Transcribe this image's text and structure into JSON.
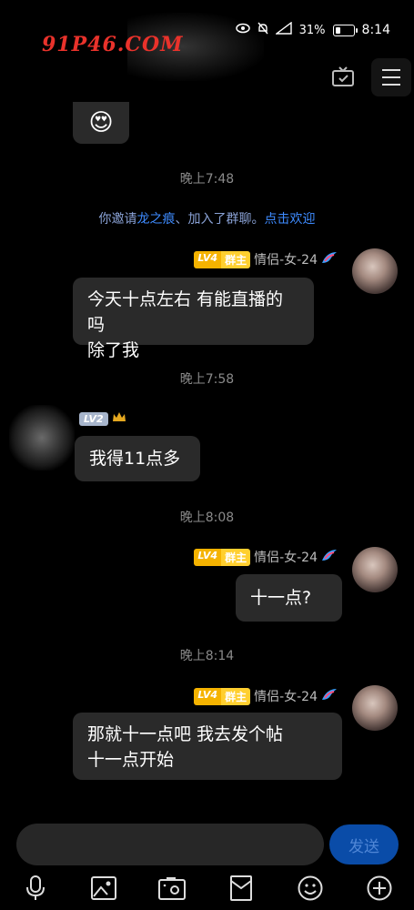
{
  "status_bar": {
    "watermark": "91P46.COM",
    "battery": "31%",
    "time": "8:14"
  },
  "emoji": "😍",
  "messages": [
    {
      "time": "晚上7:48"
    },
    {
      "system_prefix": "你邀请",
      "system_name": "龙之痕",
      "system_mid": "、加入了群聊。",
      "system_action": "点击欢迎"
    },
    {
      "sender": "情侣-女-24",
      "level": "LV4",
      "role": "群主",
      "lines": [
        "今天十点左右 有能直播的吗",
        "除了我"
      ]
    },
    {
      "time": "晚上7:58"
    },
    {
      "level": "LV2",
      "text": "我得11点多"
    },
    {
      "time": "晚上8:08"
    },
    {
      "sender": "情侣-女-24",
      "level": "LV4",
      "role": "群主",
      "text": "十一点?"
    },
    {
      "time": "晚上8:14"
    },
    {
      "sender": "情侣-女-24",
      "level": "LV4",
      "role": "群主",
      "lines": [
        "那就十一点吧 我去发个帖",
        "十一点开始"
      ]
    }
  ],
  "composer": {
    "send_label": "发送"
  },
  "toolbar": [
    "mic-icon",
    "image-icon",
    "camera-icon",
    "red-packet-icon",
    "emoji-icon",
    "plus-icon"
  ]
}
